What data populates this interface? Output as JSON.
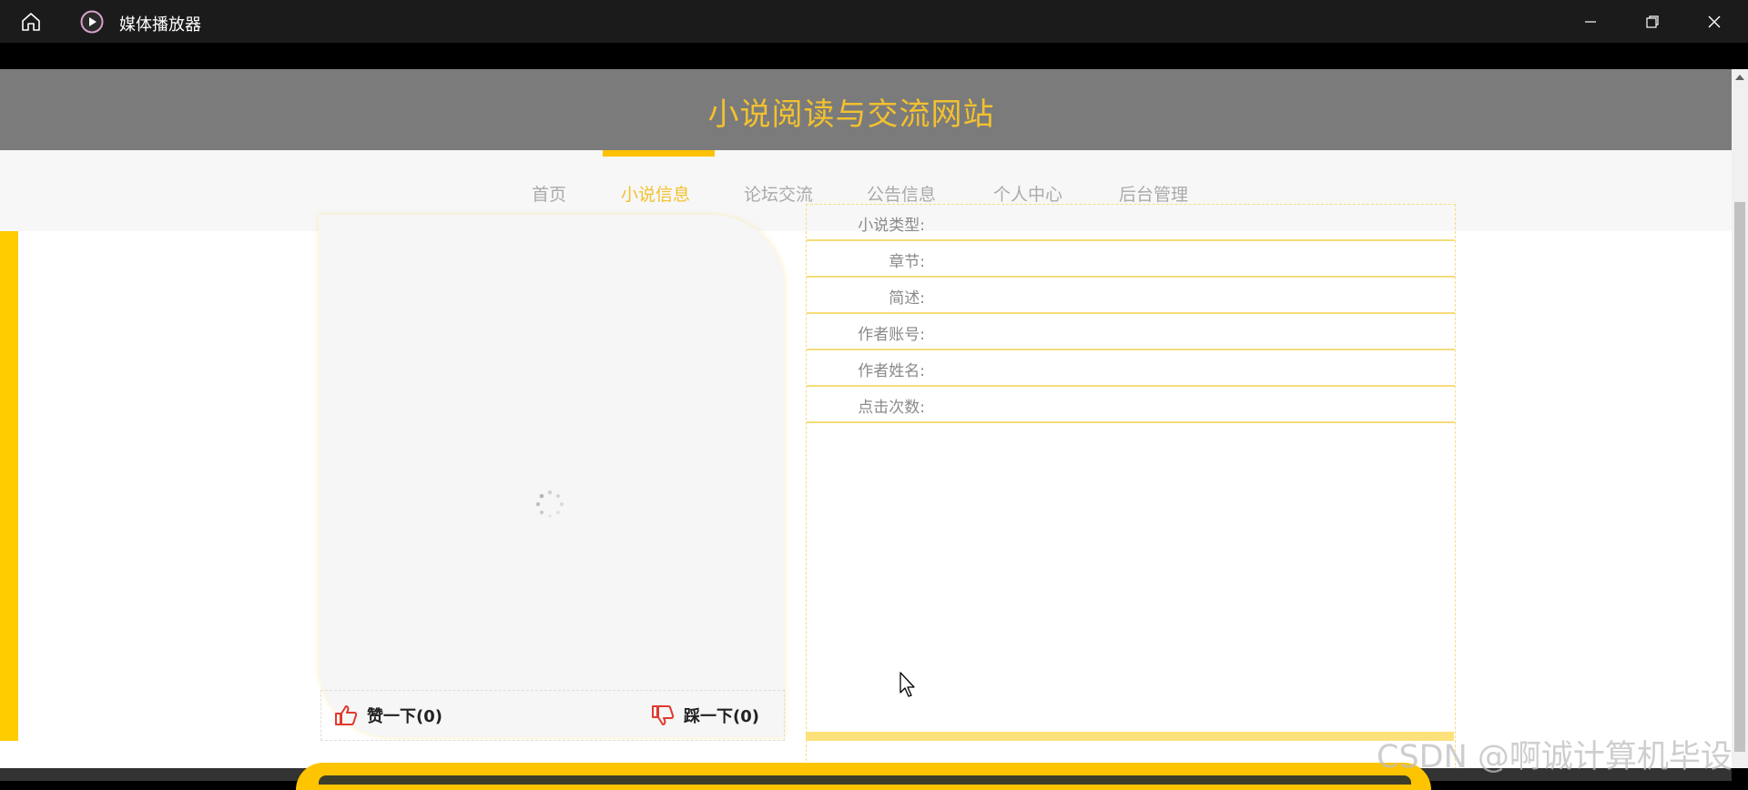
{
  "window": {
    "title": "媒体播放器"
  },
  "site": {
    "title": "小说阅读与交流网站",
    "nav": [
      {
        "label": "首页",
        "active": false
      },
      {
        "label": "小说信息",
        "active": true
      },
      {
        "label": "论坛交流",
        "active": false
      },
      {
        "label": "公告信息",
        "active": false
      },
      {
        "label": "个人中心",
        "active": false
      },
      {
        "label": "后台管理",
        "active": false
      }
    ]
  },
  "detail": {
    "fields": [
      {
        "label": "小说类型:",
        "value": ""
      },
      {
        "label": "章节:",
        "value": ""
      },
      {
        "label": "简述:",
        "value": ""
      },
      {
        "label": "作者账号:",
        "value": ""
      },
      {
        "label": "作者姓名:",
        "value": ""
      },
      {
        "label": "点击次数:",
        "value": ""
      }
    ]
  },
  "votes": {
    "like_label": "赞一下(0)",
    "dislike_label": "踩一下(0)"
  },
  "watermark": "CSDN @啊诚计算机毕设",
  "colors": {
    "accent": "#fcc200",
    "title": "#f2c12e",
    "header_bg": "#7b7b7c",
    "nav_bg": "#f7f7f7"
  }
}
